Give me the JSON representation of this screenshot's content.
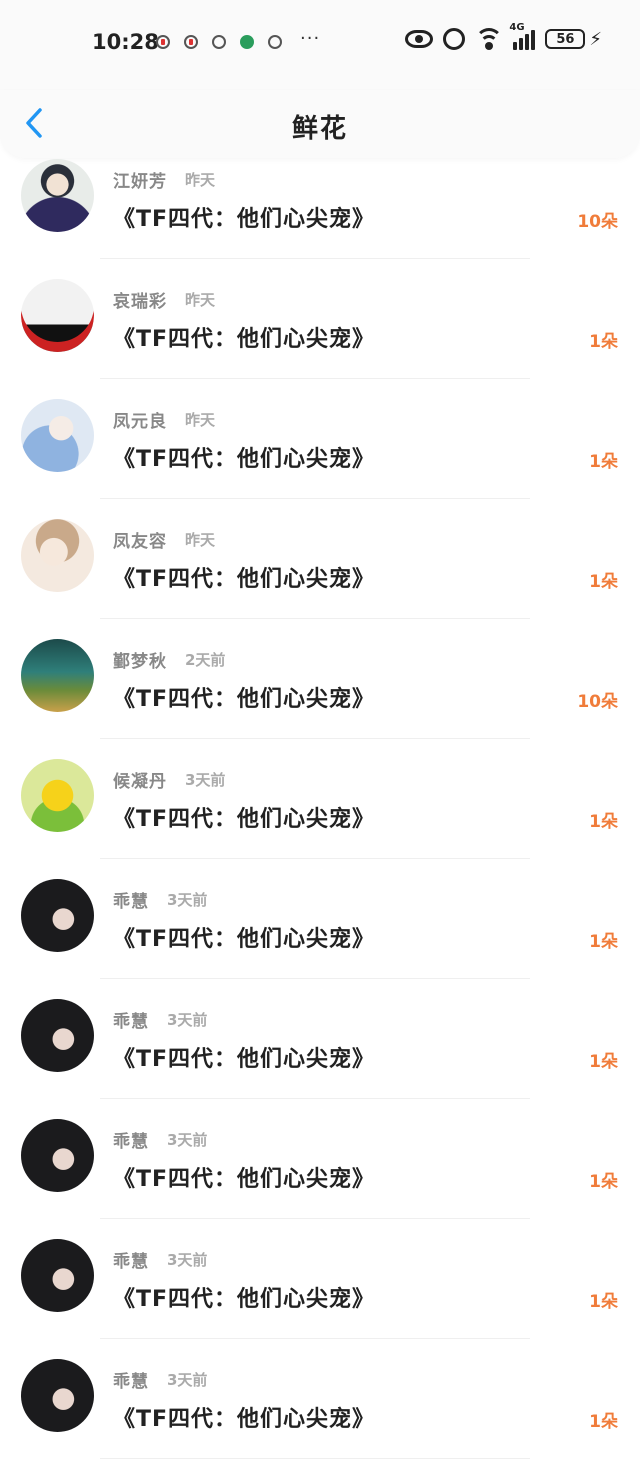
{
  "status_bar": {
    "time": "10:28",
    "more": "···",
    "network": "4G",
    "battery": "56"
  },
  "nav": {
    "title": "鲜花"
  },
  "items": [
    {
      "name": "江妍芳",
      "time": "昨天",
      "book": "《TF四代：他们心尖宠》",
      "count": "10朵"
    },
    {
      "name": "哀瑞彩",
      "time": "昨天",
      "book": "《TF四代：他们心尖宠》",
      "count": "1朵"
    },
    {
      "name": "凤元良",
      "time": "昨天",
      "book": "《TF四代：他们心尖宠》",
      "count": "1朵"
    },
    {
      "name": "凤友容",
      "time": "昨天",
      "book": "《TF四代：他们心尖宠》",
      "count": "1朵"
    },
    {
      "name": "鄞梦秋",
      "time": "2天前",
      "book": "《TF四代：他们心尖宠》",
      "count": "10朵"
    },
    {
      "name": "候凝丹",
      "time": "3天前",
      "book": "《TF四代：他们心尖宠》",
      "count": "1朵"
    },
    {
      "name": "乖慧",
      "time": "3天前",
      "book": "《TF四代：他们心尖宠》",
      "count": "1朵"
    },
    {
      "name": "乖慧",
      "time": "3天前",
      "book": "《TF四代：他们心尖宠》",
      "count": "1朵"
    },
    {
      "name": "乖慧",
      "time": "3天前",
      "book": "《TF四代：他们心尖宠》",
      "count": "1朵"
    },
    {
      "name": "乖慧",
      "time": "3天前",
      "book": "《TF四代：他们心尖宠》",
      "count": "1朵"
    },
    {
      "name": "乖慧",
      "time": "3天前",
      "book": "《TF四代：他们心尖宠》",
      "count": "1朵"
    }
  ],
  "colors": {
    "accent": "#f07c3a",
    "back_arrow": "#2196f3"
  }
}
